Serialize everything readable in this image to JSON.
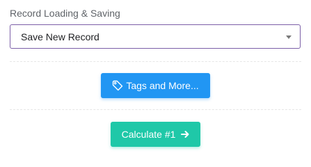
{
  "record_section": {
    "label": "Record Loading & Saving",
    "select": {
      "selected": "Save New Record"
    }
  },
  "tags_button": {
    "label": "Tags and More...",
    "icon": "tag-icon",
    "color": "#2196f3"
  },
  "calculate_button": {
    "label": "Calculate #1",
    "icon": "arrow-right-icon",
    "color": "#1fc8a8"
  },
  "colors": {
    "select_border": "#7b5ea7",
    "label_text": "#5f6368"
  }
}
